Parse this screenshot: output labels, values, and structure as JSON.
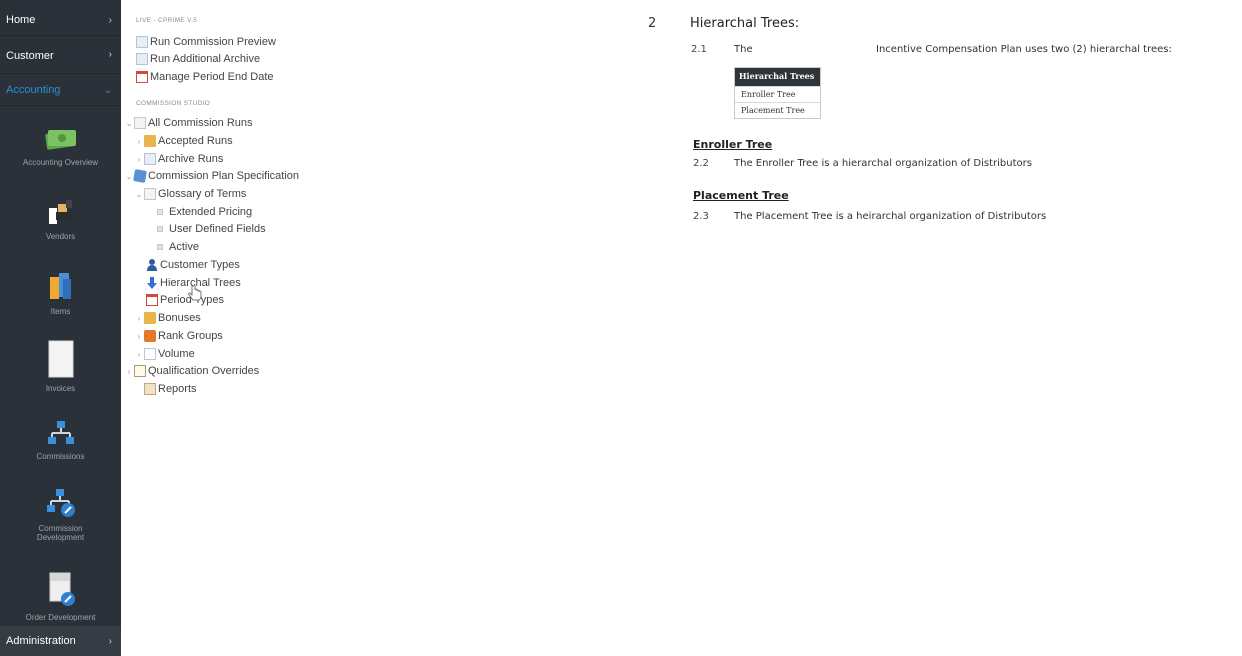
{
  "leftnav": {
    "home_label": "Home",
    "customer_label": "Customer",
    "accounting_label": "Accounting",
    "items": [
      {
        "label": "Accounting Overview",
        "icon": "money-icon"
      },
      {
        "label": "Vendors",
        "icon": "vendor-handshake-icon"
      },
      {
        "label": "Items",
        "icon": "items-icon"
      },
      {
        "label": "Invoices",
        "icon": "invoice-icon"
      },
      {
        "label": "Commissions",
        "icon": "commissions-tree-icon"
      },
      {
        "label": "Commission Development",
        "icon": "commission-development-icon"
      },
      {
        "label": "Order Development",
        "icon": "order-development-icon"
      }
    ],
    "admin_label": "Administration"
  },
  "tree": {
    "section1": "LIVE - CPRIME V.5",
    "run_preview": "Run Commission Preview",
    "run_archive": "Run Additional Archive",
    "manage_period": "Manage Period End Date",
    "section2": "COMMISSION STUDIO",
    "all_runs": "All Commission Runs",
    "accepted_runs": "Accepted Runs",
    "archive_runs": "Archive Runs",
    "plan_spec": "Commission Plan Specification",
    "glossary": "Glossary of Terms",
    "extended_pricing": "Extended Pricing",
    "user_defined": "User Defined Fields",
    "active": "Active",
    "customer_types": "Customer Types",
    "hierarchal_trees": "Hierarchal Trees",
    "period_types": "Period Types",
    "bonuses": "Bonuses",
    "rank_groups": "Rank Groups",
    "volume": "Volume",
    "qualification_overrides": "Qualification Overrides",
    "reports": "Reports"
  },
  "content": {
    "section_number": "2",
    "section_title": "Hierarchal Trees:",
    "p1_num": "2.1",
    "p1_word": "The",
    "p1_text": "Incentive Compensation Plan uses two (2) hierarchal trees:",
    "table_header": "Hierarchal Trees",
    "table_rows": [
      "Enroller Tree",
      "Placement Tree"
    ],
    "enroller_heading": "Enroller Tree",
    "p2_num": "2.2",
    "p2_text": "The Enroller Tree is a hierarchal organization of Distributors",
    "placement_heading": "Placement Tree",
    "p3_num": "2.3",
    "p3_text": "The Placement Tree is a heirarchal organization of Distributors"
  }
}
